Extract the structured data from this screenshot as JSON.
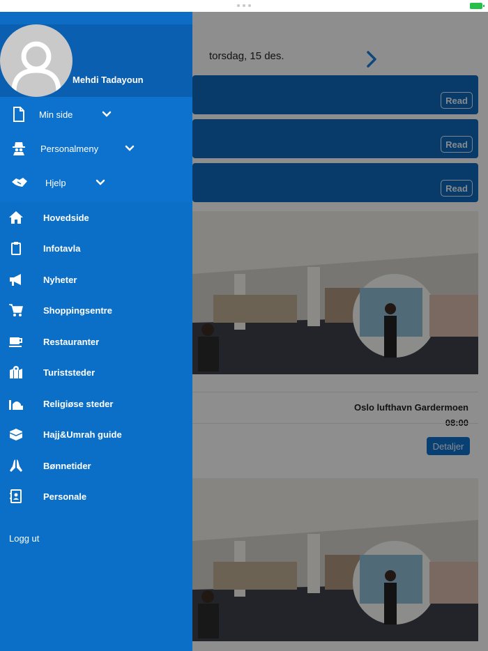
{
  "status_bar": {
    "battery_icon": "battery-charging-icon"
  },
  "main": {
    "date": "torsdag, 15 des.",
    "next_icon": "chevron-right-icon",
    "banners": [
      {
        "read_label": "Read"
      },
      {
        "read_label": "Read"
      },
      {
        "read_label": "Read"
      }
    ],
    "event": {
      "location": "Oslo lufthavn Gardermoen",
      "time": "08:00",
      "details_label": "Detaljer"
    }
  },
  "drawer": {
    "user_name": "Mehdi Tadayoun",
    "avatar_icon": "user-icon",
    "groups": [
      {
        "label": "Min side",
        "icon": "file-icon"
      },
      {
        "label": "Personalmeny",
        "icon": "spy-icon"
      },
      {
        "label": "Hjelp",
        "icon": "handshake-icon"
      }
    ],
    "items": [
      {
        "label": "Hovedside",
        "icon": "home-icon"
      },
      {
        "label": "Infotavla",
        "icon": "clipboard-icon"
      },
      {
        "label": "Nyheter",
        "icon": "megaphone-icon"
      },
      {
        "label": "Shoppingsentre",
        "icon": "cart-icon"
      },
      {
        "label": "Restauranter",
        "icon": "coffee-icon"
      },
      {
        "label": "Turiststeder",
        "icon": "map-icon"
      },
      {
        "label": "Religiøse steder",
        "icon": "mosque-icon"
      },
      {
        "label": "Hajj&Umrah guide",
        "icon": "kaaba-icon"
      },
      {
        "label": "Bønnetider",
        "icon": "praying-hands-icon"
      },
      {
        "label": "Personale",
        "icon": "contact-book-icon"
      }
    ],
    "logout_label": "Logg ut"
  },
  "colors": {
    "drawer_blue": "#0b6fc7",
    "profile_blue": "#0a5fb0",
    "banner_blue": "#0f67b5",
    "accent": "#1a7ad6"
  }
}
